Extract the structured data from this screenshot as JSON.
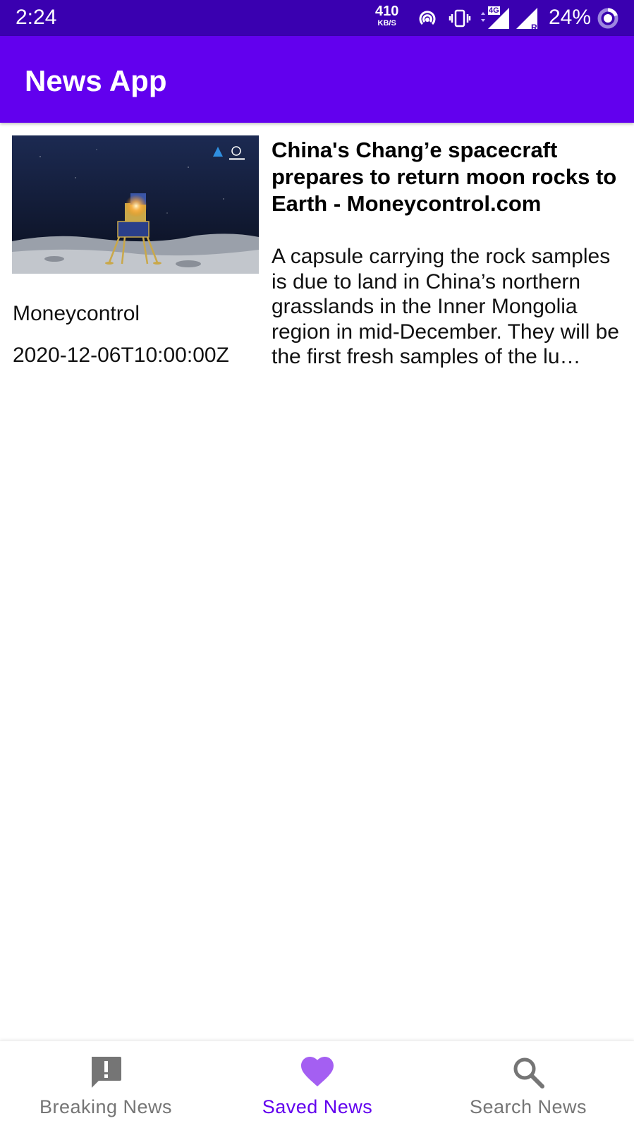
{
  "status_bar": {
    "time": "2:24",
    "net_speed_value": "410",
    "net_speed_unit": "KB/S",
    "network_type": "4G",
    "roaming": "R",
    "battery_percent": "24%"
  },
  "app_bar": {
    "title": "News App",
    "color": "#6200ee"
  },
  "articles": [
    {
      "source": "Moneycontrol",
      "published_at": "2020-12-06T10:00:00Z",
      "title": "China's Chang’e spacecraft prepares to return moon rocks to Earth - Moneycontrol.com",
      "description": "A capsule carrying the rock samples is due to land in China’s northern grasslands in the Inner Mongolia region in mid-December. They will be the first fresh samples of the lu…",
      "thumbnail_icon": "moon-lander-image"
    }
  ],
  "bottom_nav": {
    "selected_index": 1,
    "active_color": "#6200ee",
    "inactive_color": "#757575",
    "items": [
      {
        "label": "Breaking News",
        "icon": "alert-message-icon"
      },
      {
        "label": "Saved News",
        "icon": "heart-icon"
      },
      {
        "label": "Search News",
        "icon": "search-icon"
      }
    ]
  }
}
